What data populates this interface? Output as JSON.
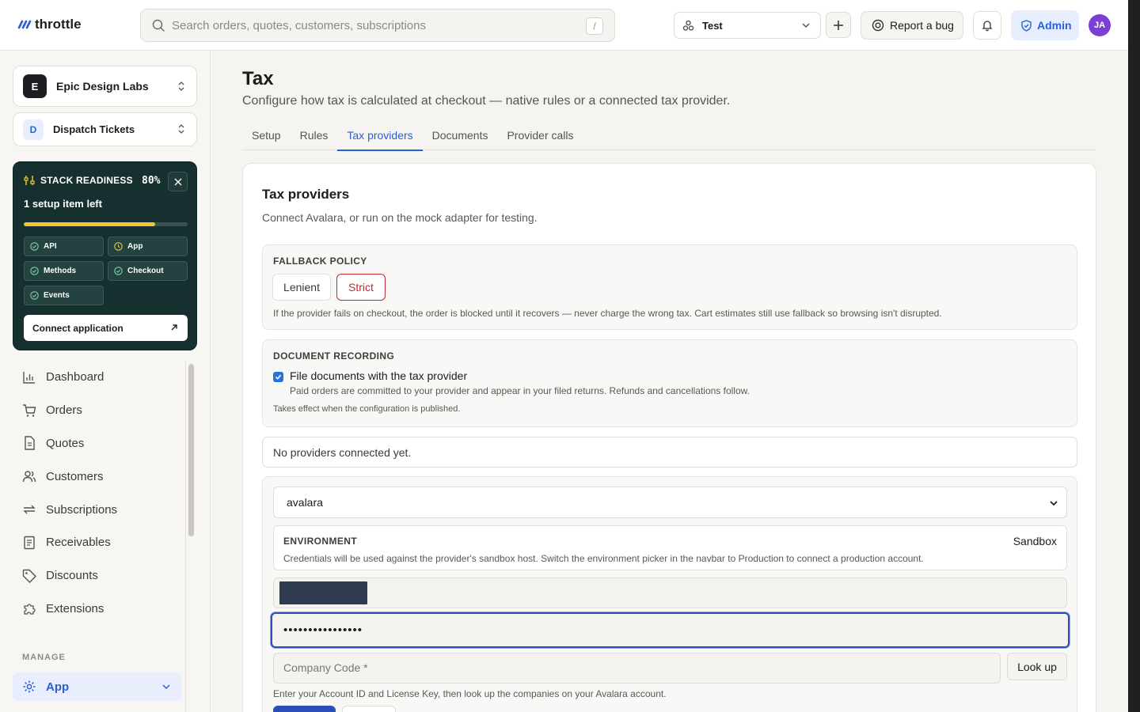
{
  "topbar": {
    "brand": "throttle",
    "search_placeholder": "Search orders, quotes, customers, subscriptions",
    "search_shortcut": "/",
    "environment": "Test",
    "report_bug": "Report a bug",
    "admin": "Admin",
    "avatar_initials": "JA"
  },
  "sidebar": {
    "org": {
      "badge": "E",
      "name": "Epic Design Labs"
    },
    "app": {
      "badge": "D",
      "name": "Dispatch Tickets"
    },
    "readiness": {
      "heading": "STACK READINESS",
      "percent": "80%",
      "percent_value": 0.8,
      "subtitle": "1 setup item left",
      "chips": [
        {
          "label": "API",
          "status": "done"
        },
        {
          "label": "App",
          "status": "pending"
        },
        {
          "label": "Methods",
          "status": "done"
        },
        {
          "label": "Checkout",
          "status": "done"
        },
        {
          "label": "Events",
          "status": "done"
        }
      ],
      "connect_label": "Connect application"
    },
    "nav": [
      {
        "label": "Dashboard",
        "icon": "chart-icon"
      },
      {
        "label": "Orders",
        "icon": "cart-icon"
      },
      {
        "label": "Quotes",
        "icon": "document-icon"
      },
      {
        "label": "Customers",
        "icon": "users-icon"
      },
      {
        "label": "Subscriptions",
        "icon": "repeat-icon"
      },
      {
        "label": "Receivables",
        "icon": "receipt-icon"
      },
      {
        "label": "Discounts",
        "icon": "tag-icon"
      },
      {
        "label": "Extensions",
        "icon": "puzzle-icon"
      }
    ],
    "manage_heading": "MANAGE",
    "active_item": "App"
  },
  "page": {
    "title": "Tax",
    "subtitle": "Configure how tax is calculated at checkout — native rules or a connected tax provider.",
    "tabs": [
      "Setup",
      "Rules",
      "Tax providers",
      "Documents",
      "Provider calls"
    ],
    "active_tab": "Tax providers"
  },
  "card": {
    "title": "Tax providers",
    "subtitle": "Connect Avalara, or run on the mock adapter for testing.",
    "fallback": {
      "label": "FALLBACK POLICY",
      "options": [
        "Lenient",
        "Strict"
      ],
      "selected": "Strict",
      "note": "If the provider fails on checkout, the order is blocked until it recovers — never charge the wrong tax. Cart estimates still use fallback so browsing isn't disrupted."
    },
    "recording": {
      "label": "DOCUMENT RECORDING",
      "checkbox_label": "File documents with the tax provider",
      "checked": true,
      "description": "Paid orders are committed to your provider and appear in your filed returns. Refunds and cancellations follow.",
      "note": "Takes effect when the configuration is published."
    },
    "empty_state": "No providers connected yet.",
    "form": {
      "provider": "avalara",
      "env_label": "ENVIRONMENT",
      "env_value": "Sandbox",
      "env_description": "Credentials will be used against the provider's sandbox host. Switch the environment picker in the navbar to Production to connect a production account.",
      "license_key_masked": "••••••••••••••••",
      "company_code_placeholder": "Company Code *",
      "lookup_label": "Look up",
      "hint": "Enter your Account ID and License Key, then look up the companies on your Avalara account."
    }
  },
  "colors": {
    "accent": "#2b5fd9",
    "danger": "#c0292e",
    "readiness_bg": "#15302e",
    "progress": "#f2c531"
  }
}
